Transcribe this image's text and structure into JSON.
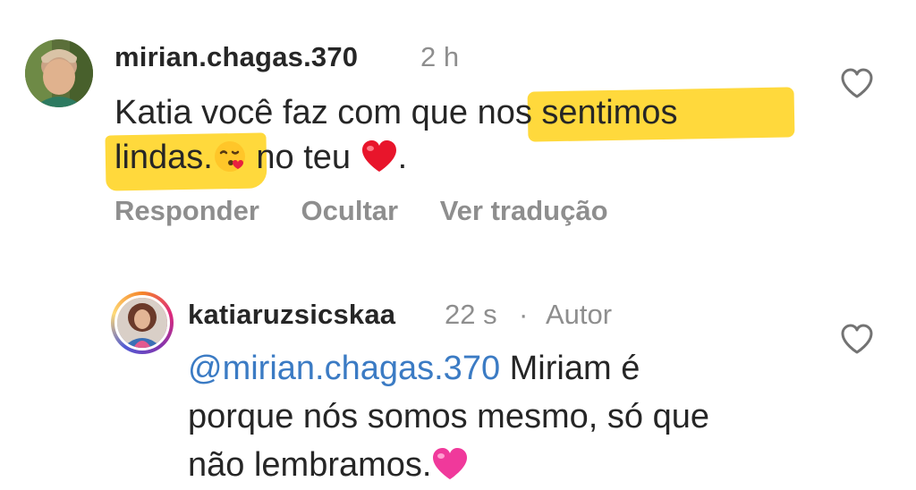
{
  "comments": [
    {
      "username": "mirian.chagas.370",
      "time": "2 h",
      "text_line1_plain": "Katia você  faz com que ",
      "text_line1_hl": "nos sentimos",
      "text_line2_hl": "lindas.",
      "text_line2_rest": " no teu ",
      "text_line2_end": ".",
      "emoji_kiss": "kiss-heart-emoji",
      "emoji_heart": "red-heart-emoji",
      "actions": {
        "reply": "Responder",
        "hide": "Ocultar",
        "translate": "Ver tradução"
      },
      "like_icon": "heart-outline-icon"
    },
    {
      "username": "katiaruzsicskaa",
      "time": "22 s",
      "dot": "·",
      "author_label": "Autor",
      "mention": "@mirian.chagas.370",
      "text_line1_rest": " Miriam é",
      "text_line2": "porque nós somos mesmo, só que",
      "text_line3": "não lembramos.",
      "emoji_heart": "pink-heart-emoji",
      "like_icon": "heart-outline-icon"
    }
  ],
  "colors": {
    "highlight": "#ffd21a",
    "mention": "#3b7bc4",
    "secondary_text": "#8e8e8e",
    "primary_text": "#262626"
  }
}
